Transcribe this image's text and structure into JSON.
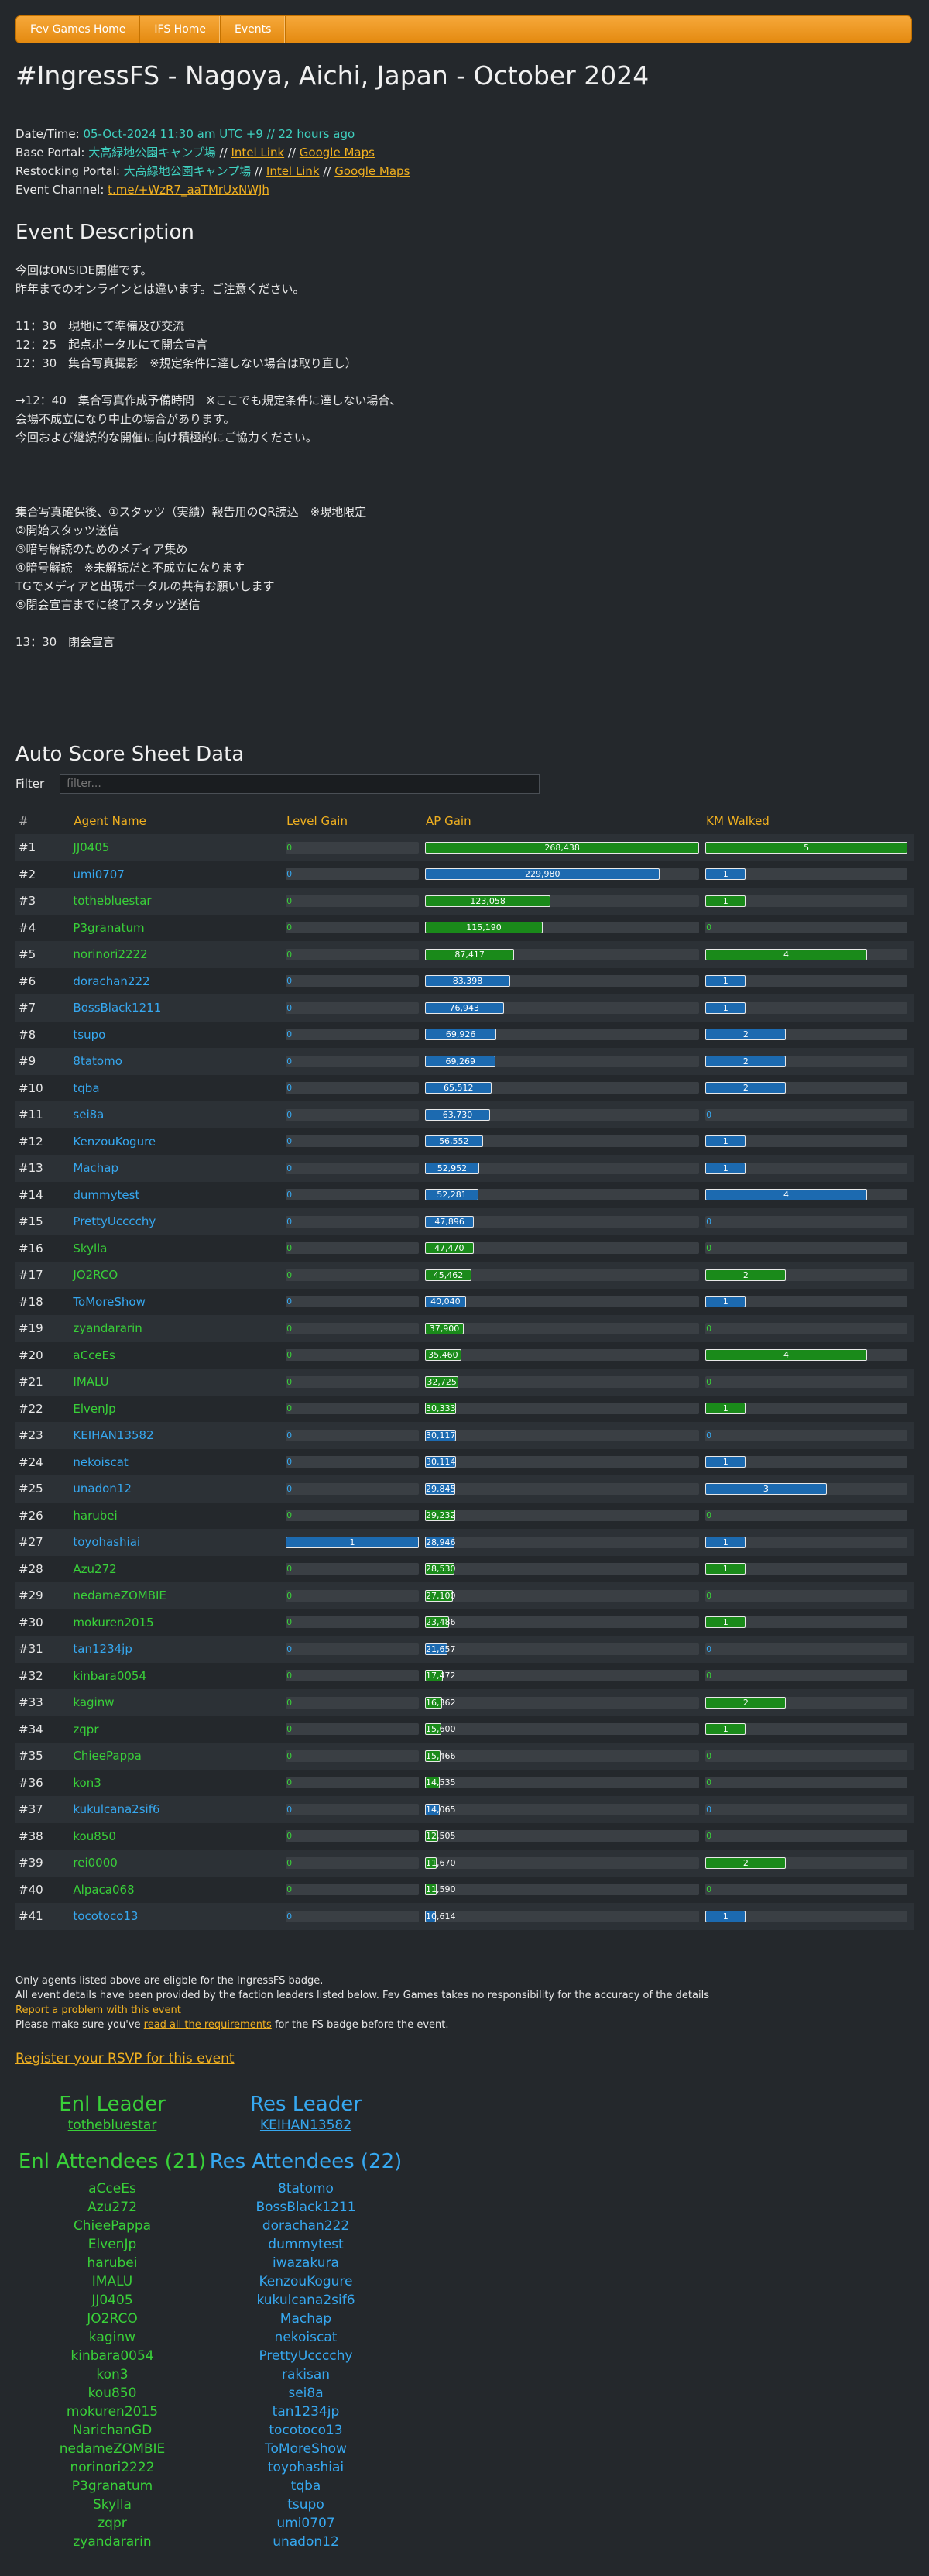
{
  "nav": [
    "Fev Games Home",
    "IFS Home",
    "Events"
  ],
  "page_title": "#IngressFS - Nagoya, Aichi, Japan - October 2024",
  "meta": {
    "datetime_label": "Date/Time: ",
    "datetime_value": "05-Oct-2024 11:30 am UTC +9 // 22 hours ago",
    "base_label": "Base Portal: ",
    "base_name": "大高緑地公園キャンプ場",
    "sep": " // ",
    "intel": "Intel Link",
    "gmaps": "Google Maps",
    "restock_label": "Restocking Portal: ",
    "restock_name": "大高緑地公園キャンプ場",
    "channel_label": "Event Channel: ",
    "channel_link": "t.me/+WzR7_aaTMrUxNWJh"
  },
  "description_heading": "Event Description",
  "description": "今回はONSIDE開催です。\n昨年までのオンラインとは違います。ご注意ください。\n\n11：30　現地にて準備及び交流\n12：25　起点ポータルにて開会宣言\n12：30　集合写真撮影　※規定条件に達しない場合は取り直し）\n\n→12：40　集合写真作成予備時間　※ここでも規定条件に達しない場合、\n会場不成立になり中止の場合があります。\n今回および継続的な開催に向け積極的にご協力ください。\n\n\n\n集合写真確保後、①スタッツ（実績）報告用のQR読込　※現地限定\n②開始スタッツ送信\n③暗号解読のためのメディア集め\n④暗号解読　※未解読だと不成立になります\nTGでメディアと出現ポータルの共有お願いします\n⑤閉会宣言までに終了スタッツ送信\n\n13：30　閉会宣言",
  "score_heading": "Auto Score Sheet Data",
  "filter_label": "Filter",
  "filter_placeholder": "filter...",
  "columns": {
    "rank": "#",
    "agent": "Agent Name",
    "level": "Level Gain",
    "ap": "AP Gain",
    "km": "KM Walked"
  },
  "colors": {
    "enl": "#39d039",
    "res": "#36a8f0",
    "accent": "#f0b020",
    "nav": "#f0a030"
  },
  "scale": {
    "ap_max": 268438,
    "km_max": 5,
    "level_max": 1
  },
  "rows": [
    {
      "rank": "#1",
      "agent": "JJ0405",
      "faction": "enl",
      "level": 0,
      "ap": 268438,
      "km": 5
    },
    {
      "rank": "#2",
      "agent": "umi0707",
      "faction": "res",
      "level": 0,
      "ap": 229980,
      "km": 1
    },
    {
      "rank": "#3",
      "agent": "tothebluestar",
      "faction": "enl",
      "level": 0,
      "ap": 123058,
      "km": 1
    },
    {
      "rank": "#4",
      "agent": "P3granatum",
      "faction": "enl",
      "level": 0,
      "ap": 115190,
      "km": 0
    },
    {
      "rank": "#5",
      "agent": "norinori2222",
      "faction": "enl",
      "level": 0,
      "ap": 87417,
      "km": 4
    },
    {
      "rank": "#6",
      "agent": "dorachan222",
      "faction": "res",
      "level": 0,
      "ap": 83398,
      "km": 1
    },
    {
      "rank": "#7",
      "agent": "BossBlack1211",
      "faction": "res",
      "level": 0,
      "ap": 76943,
      "km": 1
    },
    {
      "rank": "#8",
      "agent": "tsupo",
      "faction": "res",
      "level": 0,
      "ap": 69926,
      "km": 2
    },
    {
      "rank": "#9",
      "agent": "8tatomo",
      "faction": "res",
      "level": 0,
      "ap": 69269,
      "km": 2
    },
    {
      "rank": "#10",
      "agent": "tqba",
      "faction": "res",
      "level": 0,
      "ap": 65512,
      "km": 2
    },
    {
      "rank": "#11",
      "agent": "sei8a",
      "faction": "res",
      "level": 0,
      "ap": 63730,
      "km": 0
    },
    {
      "rank": "#12",
      "agent": "KenzouKogure",
      "faction": "res",
      "level": 0,
      "ap": 56552,
      "km": 1
    },
    {
      "rank": "#13",
      "agent": "Machap",
      "faction": "res",
      "level": 0,
      "ap": 52952,
      "km": 1
    },
    {
      "rank": "#14",
      "agent": "dummytest",
      "faction": "res",
      "level": 0,
      "ap": 52281,
      "km": 4
    },
    {
      "rank": "#15",
      "agent": "PrettyUcccchy",
      "faction": "res",
      "level": 0,
      "ap": 47896,
      "km": 0
    },
    {
      "rank": "#16",
      "agent": "Skylla",
      "faction": "enl",
      "level": 0,
      "ap": 47470,
      "km": 0
    },
    {
      "rank": "#17",
      "agent": "JO2RCO",
      "faction": "enl",
      "level": 0,
      "ap": 45462,
      "km": 2
    },
    {
      "rank": "#18",
      "agent": "ToMoreShow",
      "faction": "res",
      "level": 0,
      "ap": 40040,
      "km": 1
    },
    {
      "rank": "#19",
      "agent": "zyandararin",
      "faction": "enl",
      "level": 0,
      "ap": 37900,
      "km": 0
    },
    {
      "rank": "#20",
      "agent": "aCceEs",
      "faction": "enl",
      "level": 0,
      "ap": 35460,
      "km": 4
    },
    {
      "rank": "#21",
      "agent": "IMALU",
      "faction": "enl",
      "level": 0,
      "ap": 32725,
      "km": 0
    },
    {
      "rank": "#22",
      "agent": "ElvenJp",
      "faction": "enl",
      "level": 0,
      "ap": 30333,
      "km": 1
    },
    {
      "rank": "#23",
      "agent": "KEIHAN13582",
      "faction": "res",
      "level": 0,
      "ap": 30117,
      "km": 0
    },
    {
      "rank": "#24",
      "agent": "nekoiscat",
      "faction": "res",
      "level": 0,
      "ap": 30114,
      "km": 1
    },
    {
      "rank": "#25",
      "agent": "unadon12",
      "faction": "res",
      "level": 0,
      "ap": 29845,
      "km": 3
    },
    {
      "rank": "#26",
      "agent": "harubei",
      "faction": "enl",
      "level": 0,
      "ap": 29232,
      "km": 0
    },
    {
      "rank": "#27",
      "agent": "toyohashiai",
      "faction": "res",
      "level": 1,
      "ap": 28946,
      "km": 1
    },
    {
      "rank": "#28",
      "agent": "Azu272",
      "faction": "enl",
      "level": 0,
      "ap": 28530,
      "km": 1
    },
    {
      "rank": "#29",
      "agent": "nedameZOMBIE",
      "faction": "enl",
      "level": 0,
      "ap": 27100,
      "km": 0
    },
    {
      "rank": "#30",
      "agent": "mokuren2015",
      "faction": "enl",
      "level": 0,
      "ap": 23486,
      "km": 1
    },
    {
      "rank": "#31",
      "agent": "tan1234jp",
      "faction": "res",
      "level": 0,
      "ap": 21657,
      "km": 0
    },
    {
      "rank": "#32",
      "agent": "kinbara0054",
      "faction": "enl",
      "level": 0,
      "ap": 17472,
      "km": 0
    },
    {
      "rank": "#33",
      "agent": "kaginw",
      "faction": "enl",
      "level": 0,
      "ap": 16362,
      "km": 2
    },
    {
      "rank": "#34",
      "agent": "zqpr",
      "faction": "enl",
      "level": 0,
      "ap": 15600,
      "km": 1
    },
    {
      "rank": "#35",
      "agent": "ChieePappa",
      "faction": "enl",
      "level": 0,
      "ap": 15466,
      "km": 0
    },
    {
      "rank": "#36",
      "agent": "kon3",
      "faction": "enl",
      "level": 0,
      "ap": 14535,
      "km": 0
    },
    {
      "rank": "#37",
      "agent": "kukulcana2sif6",
      "faction": "res",
      "level": 0,
      "ap": 14065,
      "km": 0
    },
    {
      "rank": "#38",
      "agent": "kou850",
      "faction": "enl",
      "level": 0,
      "ap": 12505,
      "km": 0
    },
    {
      "rank": "#39",
      "agent": "rei0000",
      "faction": "enl",
      "level": 0,
      "ap": 11670,
      "km": 2
    },
    {
      "rank": "#40",
      "agent": "Alpaca068",
      "faction": "enl",
      "level": 0,
      "ap": 11590,
      "km": 0
    },
    {
      "rank": "#41",
      "agent": "tocotoco13",
      "faction": "res",
      "level": 0,
      "ap": 10614,
      "km": 1
    }
  ],
  "footer": {
    "line1": "Only agents listed above are eligble for the IngressFS badge.",
    "line2": "All event details have been provided by the faction leaders listed below. Fev Games takes no responsibility for the accuracy of the details",
    "report": "Report a problem with this event",
    "line4_pre": "Please make sure you've ",
    "line4_link": "read all the requirements",
    "line4_post": " for the FS badge before the event."
  },
  "rsvp": "Register your RSVP for this event",
  "enl_leader_heading": "Enl Leader",
  "enl_leader": "tothebluestar",
  "res_leader_heading": "Res Leader",
  "res_leader": "KEIHAN13582",
  "enl_attendees_heading": "Enl Attendees (21)",
  "res_attendees_heading": "Res Attendees (22)",
  "enl_attendees": [
    "aCceEs",
    "Azu272",
    "ChieePappa",
    "ElvenJp",
    "harubei",
    "IMALU",
    "JJ0405",
    "JO2RCO",
    "kaginw",
    "kinbara0054",
    "kon3",
    "kou850",
    "mokuren2015",
    "NarichanGD",
    "nedameZOMBIE",
    "norinori2222",
    "P3granatum",
    "Skylla",
    "zqpr",
    "zyandararin"
  ],
  "res_attendees": [
    "8tatomo",
    "BossBlack1211",
    "dorachan222",
    "dummytest",
    "iwazakura",
    "KenzouKogure",
    "kukulcana2sif6",
    "Machap",
    "nekoiscat",
    "PrettyUcccchy",
    "rakisan",
    "sei8a",
    "tan1234jp",
    "tocotoco13",
    "ToMoreShow",
    "toyohashiai",
    "tqba",
    "tsupo",
    "umi0707",
    "unadon12"
  ]
}
